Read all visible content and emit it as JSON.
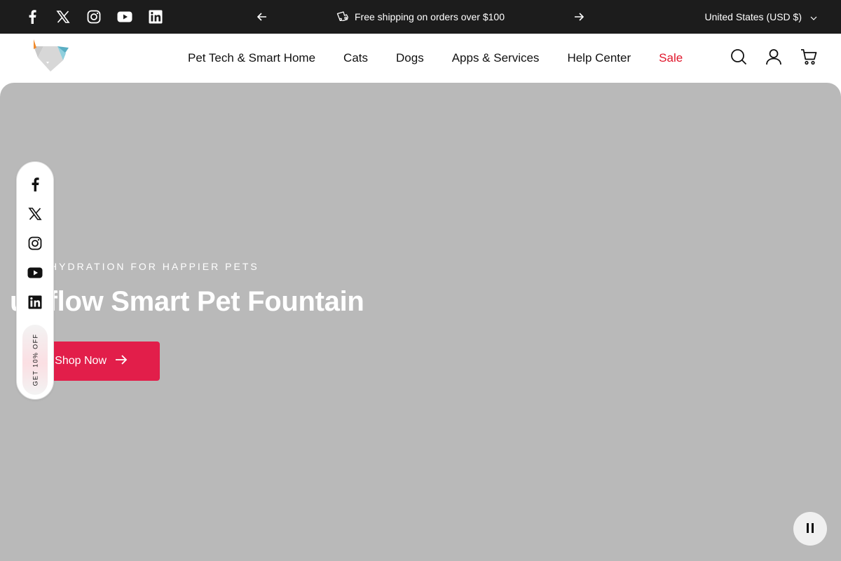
{
  "announcement": {
    "message": "Free shipping on orders over $100",
    "country": "United States (USD $)",
    "socials": [
      "facebook-icon",
      "x-icon",
      "instagram-icon",
      "youtube-icon",
      "linkedin-icon"
    ]
  },
  "header": {
    "nav": [
      {
        "label": "Pet Tech & Smart Home"
      },
      {
        "label": "Cats"
      },
      {
        "label": "Dogs"
      },
      {
        "label": "Apps & Services"
      },
      {
        "label": "Help Center"
      },
      {
        "label": "Sale"
      }
    ],
    "icons": [
      "search-icon",
      "account-icon",
      "cart-icon"
    ]
  },
  "hero": {
    "eyebrow": "RT HYDRATION FOR HAPPIER PETS",
    "title": "urrflow Smart Pet Fountain",
    "cta_label": "Shop Now"
  },
  "floating_social": {
    "discount_label": "GET 10% OFF"
  },
  "colors": {
    "announcement_bg": "#1c1c1c",
    "hero_bg": "#b9b9b9",
    "accent": "#e21e4a",
    "sale": "#e0162b"
  }
}
